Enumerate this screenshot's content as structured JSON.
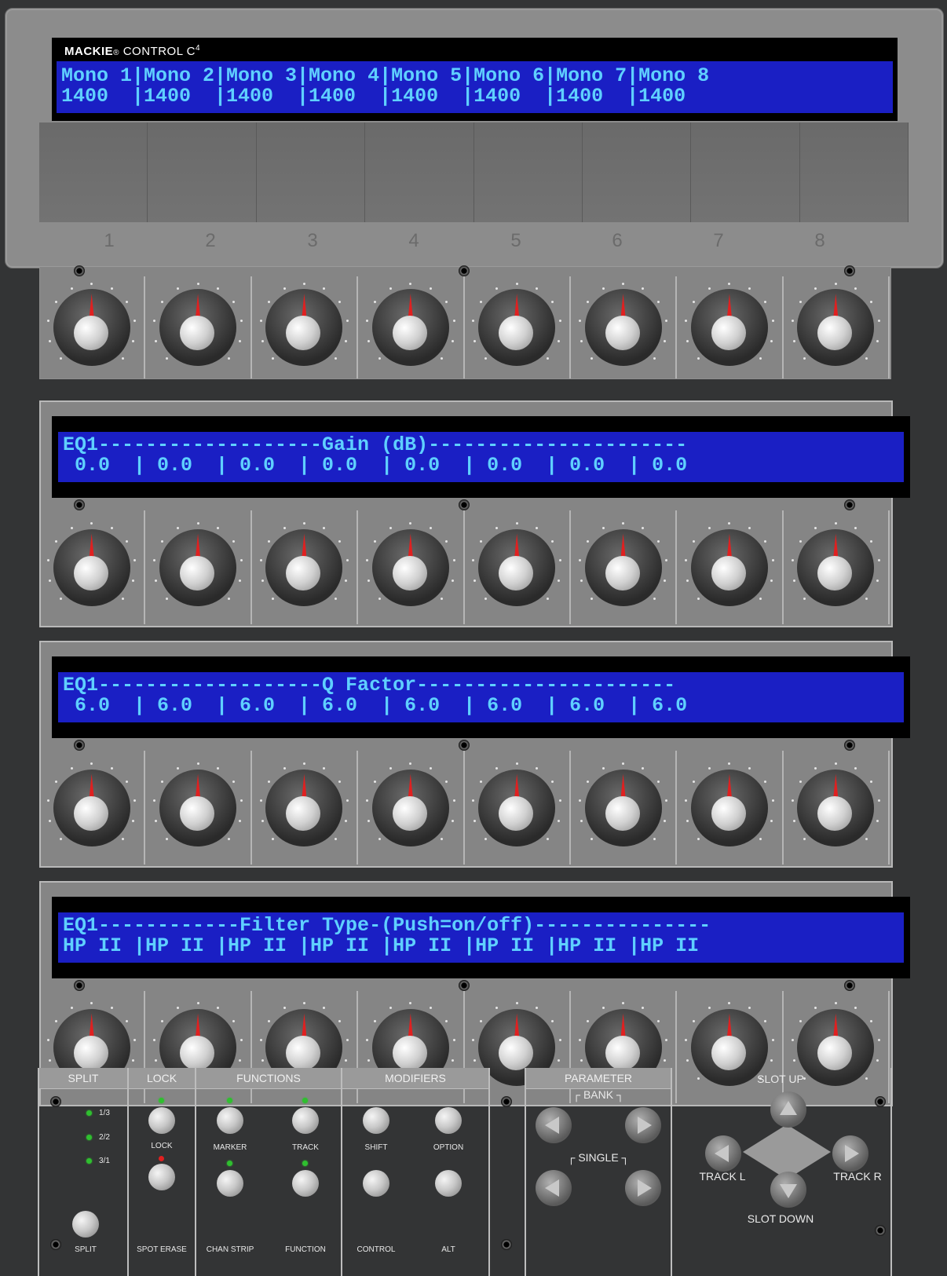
{
  "brand": {
    "name": "MACKIE",
    "reg": "®",
    "product": "CONTROL C",
    "sup": "4"
  },
  "top_lcd": {
    "line1": "Mono 1|Mono 2|Mono 3|Mono 4|Mono 5|Mono 6|Mono 7|Mono 8",
    "line2": "1400  |1400  |1400  |1400  |1400  |1400  |1400  |1400"
  },
  "tab_numbers": [
    "1",
    "2",
    "3",
    "4",
    "5",
    "6",
    "7",
    "8"
  ],
  "eq_gain": {
    "line1": "EQ1-------------------Gain (dB)----------------------",
    "line2": " 0.0  | 0.0  | 0.0  | 0.0  | 0.0  | 0.0  | 0.0  | 0.0"
  },
  "eq_q": {
    "line1": "EQ1-------------------Q Factor----------------------",
    "line2": " 6.0  | 6.0  | 6.0  | 6.0  | 6.0  | 6.0  | 6.0  | 6.0"
  },
  "eq_filter": {
    "line1": "EQ1------------Filter Type-(Push=on/off)---------------",
    "line2": "HP II |HP II |HP II |HP II |HP II |HP II |HP II |HP II"
  },
  "sections": {
    "split": {
      "title": "SPLIT",
      "opts": [
        "1/3",
        "2/2",
        "3/1"
      ],
      "button": "SPLIT"
    },
    "lock": {
      "title": "LOCK",
      "btn1": "LOCK",
      "btn2": "SPOT ERASE"
    },
    "functions": {
      "title": "FUNCTIONS",
      "btns": [
        "MARKER",
        "TRACK",
        "CHAN STRIP",
        "FUNCTION"
      ]
    },
    "modifiers": {
      "title": "MODIFIERS",
      "btns": [
        "SHIFT",
        "OPTION",
        "CONTROL",
        "ALT"
      ]
    },
    "parameter": {
      "title": "PARAMETER",
      "bank": "BANK",
      "single": "SINGLE"
    },
    "nav": {
      "up": "SLOT UP",
      "down": "SLOT DOWN",
      "left": "TRACK L",
      "right": "TRACK R"
    }
  },
  "colors": {
    "lcd_bg": "#1a1fc4",
    "lcd_text": "#5fd0ff",
    "indicator": "#e02020"
  }
}
